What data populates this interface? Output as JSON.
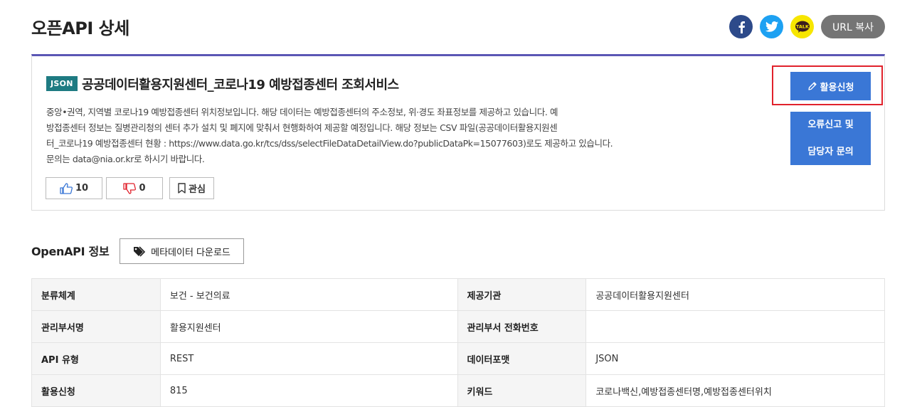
{
  "page": {
    "title": "오픈API 상세"
  },
  "share": {
    "facebook_icon": "facebook-icon",
    "twitter_icon": "twitter-icon",
    "kakao_icon": "kakaotalk-icon",
    "kakao_label": "TALK",
    "url_copy_label": "URL 복사"
  },
  "service": {
    "badge": "JSON",
    "title": "공공데이터활용지원센터_코로나19 예방접종센터 조회서비스",
    "description_lines": [
      "중앙•권역, 지역별 코로나19 예방접종센터 위치정보입니다. 해당 데이터는 예방접종센터의 주소정보, 위·경도 좌표정보를 제공하고 있습니다. 예",
      "방접종센터 정보는 질병관리청의 센터 추가 설치 및 폐지에 맞춰서 현행화하여 제공할 예정입니다. 해당 정보는 CSV 파일(공공데이터활용지원센",
      "터_코로나19 예방접종센터 현황 : https://www.data.go.kr/tcs/dss/selectFileDataDetailView.do?publicDataPk=15077603)로도 제공하고 있습니다.",
      "문의는 data@nia.or.kr로 하시기 바랍니다."
    ],
    "likes": "10",
    "dislikes": "0",
    "favorite_label": "관심",
    "apply_label": "활용신청",
    "report_line1": "오류신고 및",
    "report_line2": "담당자 문의"
  },
  "openapi": {
    "section_title": "OpenAPI 정보",
    "meta_download_label": "메타데이터 다운로드",
    "rows": [
      [
        "분류체계",
        "보건 - 보건의료",
        "제공기관",
        "공공데이터활용지원센터"
      ],
      [
        "관리부서명",
        "활용지원센터",
        "관리부서 전화번호",
        ""
      ],
      [
        "API 유형",
        "REST",
        "데이터포맷",
        "JSON"
      ],
      [
        "활용신청",
        "815",
        "키워드",
        "코로나백신,예방접종센터명,예방접종센터위치"
      ]
    ]
  },
  "colors": {
    "accent_border": "#5b57b5",
    "badge": "#1e7b82",
    "primary_button": "#3a77d6",
    "highlight": "#e1222c"
  }
}
